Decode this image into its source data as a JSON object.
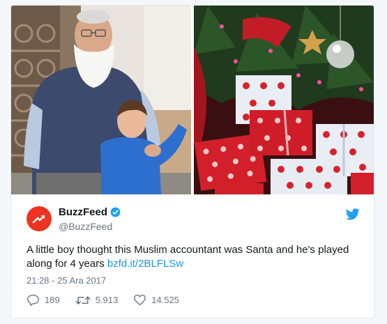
{
  "tweet": {
    "author": {
      "display_name": "BuzzFeed",
      "handle": "@BuzzFeed",
      "verified": true,
      "avatar_icon": "buzzfeed-trend-arrow-icon",
      "avatar_color": "#ee3322"
    },
    "text": "A little boy thought this Muslim accountant was Santa and he's played along for 4 years",
    "link_text": "bzfd.it/2BLFLSw",
    "timestamp": "21:28 - 25 Ara 2017",
    "replies": "189",
    "retweets": "5.913",
    "likes": "14.525",
    "media": [
      {
        "icon": "photo-man-and-boy"
      },
      {
        "icon": "photo-christmas-presents"
      }
    ]
  },
  "colors": {
    "link": "#1b95e0",
    "twitter_blue": "#1da1f2",
    "text": "#14171a",
    "muted": "#657786"
  }
}
